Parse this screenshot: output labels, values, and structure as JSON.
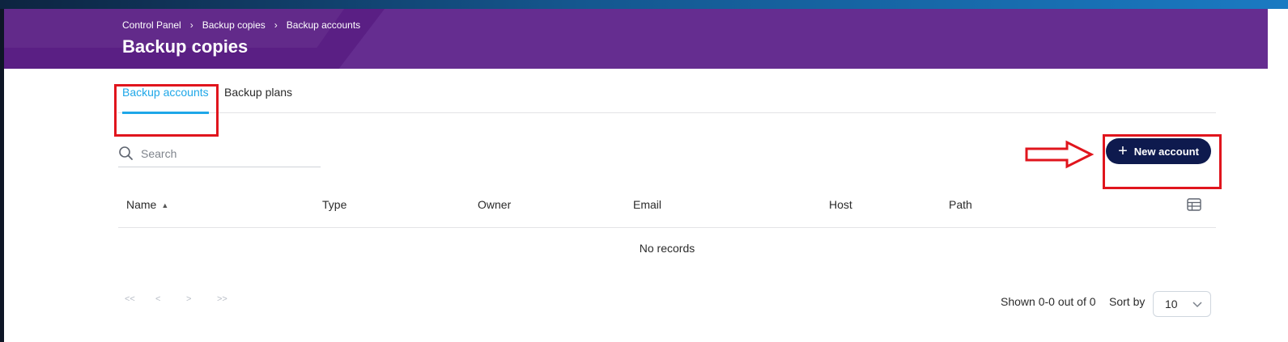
{
  "breadcrumb": [
    {
      "label": "Control Panel"
    },
    {
      "label": "Backup copies"
    },
    {
      "label": "Backup accounts"
    }
  ],
  "breadcrumb_separator": "›",
  "page": {
    "title": "Backup copies"
  },
  "tabs": [
    {
      "label": "Backup accounts",
      "active": true
    },
    {
      "label": "Backup plans",
      "active": false
    }
  ],
  "search": {
    "placeholder": "Search",
    "value": ""
  },
  "toolbar": {
    "new_account_label": "New account",
    "plus_glyph": "+"
  },
  "table": {
    "columns": [
      {
        "label": "Name",
        "sort": "ascending",
        "sort_glyph": "▲"
      },
      {
        "label": "Type"
      },
      {
        "label": "Owner"
      },
      {
        "label": "Email"
      },
      {
        "label": "Host"
      },
      {
        "label": "Path"
      }
    ],
    "rows": [],
    "empty_text": "No records"
  },
  "pagination": {
    "first": "<<",
    "prev": "<",
    "next": ">",
    "last": ">>",
    "shown_text": "Shown 0-0 out of 0",
    "sort_by_label": "Sort by",
    "page_size": "10"
  },
  "icons": {
    "search": "search-icon",
    "plus": "plus-icon",
    "columns": "table-columns-icon",
    "chevron": "chevron-down-icon",
    "annotation_arrow": "arrow-right-icon"
  },
  "colors": {
    "header_purple": "#652d90",
    "active_tab_blue": "#1ea7e8",
    "primary_button": "#0e1a4e",
    "annotation_red": "#e0151d"
  }
}
